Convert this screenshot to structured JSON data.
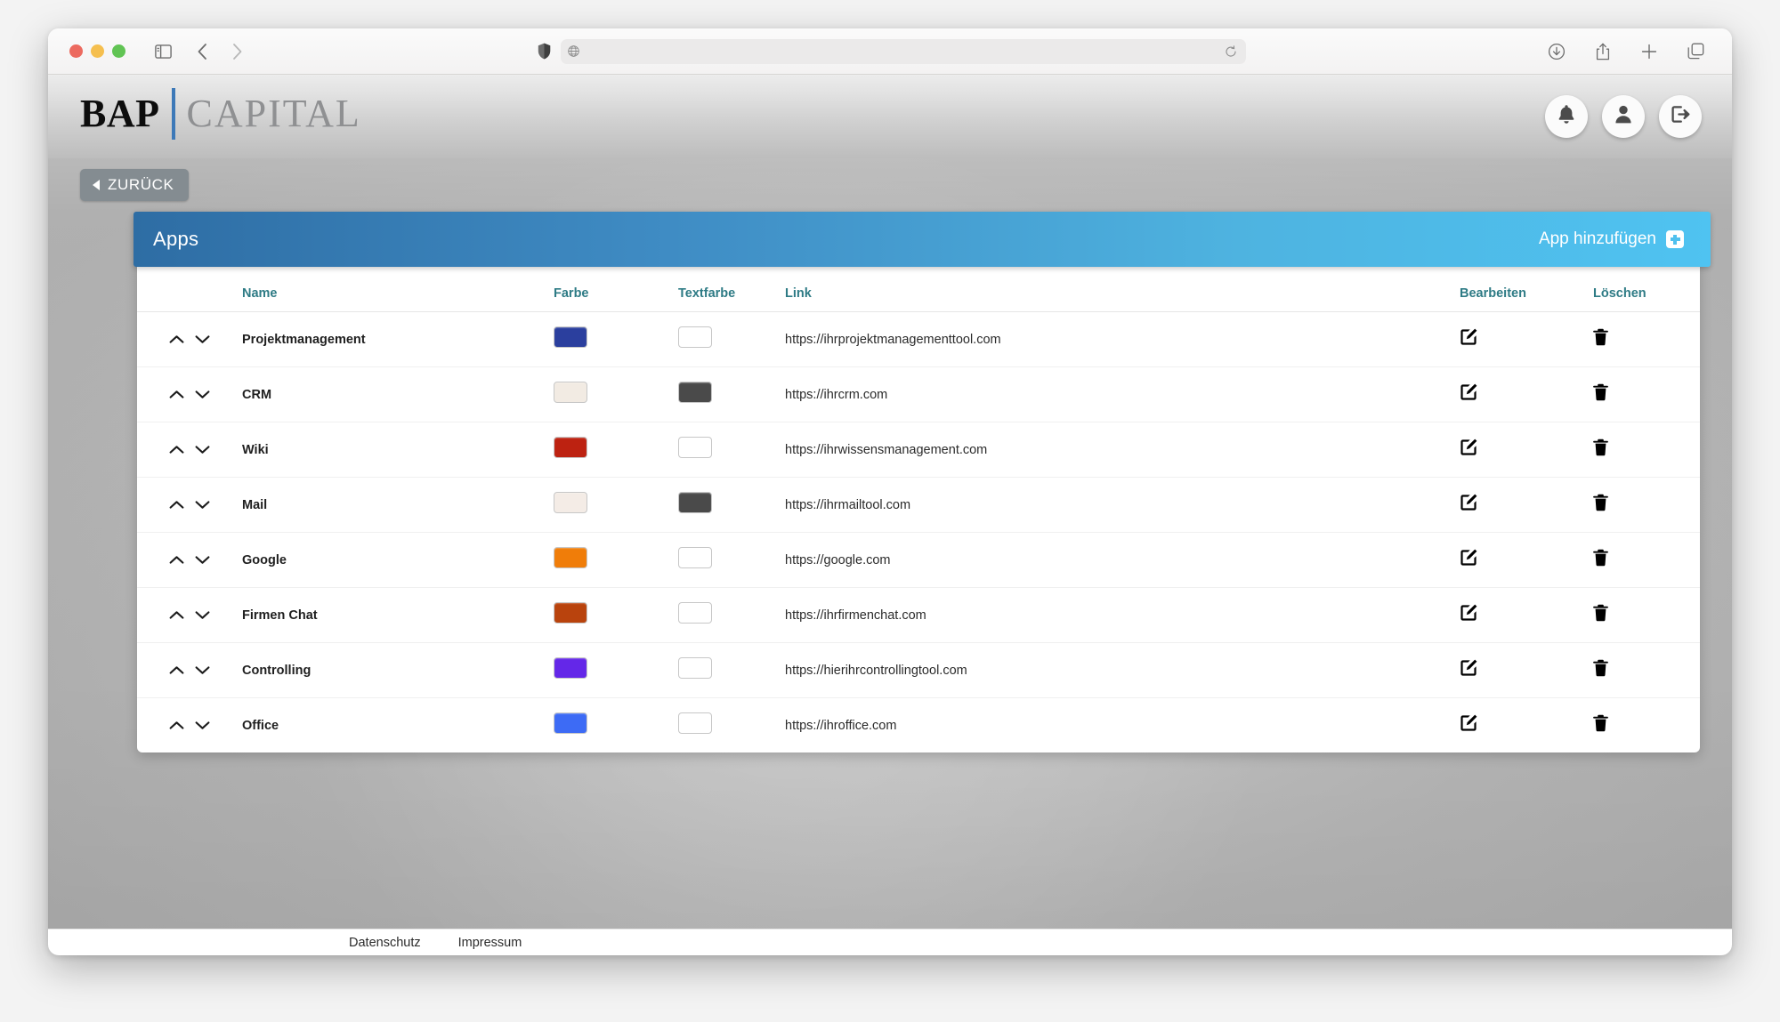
{
  "browser": {
    "url_value": "",
    "url_placeholder": "",
    "icons": {
      "sidebar": "sidebar-toggle-icon",
      "back": "back-arrow-icon",
      "forward": "forward-arrow-icon",
      "shield": "privacy-shield-icon",
      "globe": "globe-icon",
      "reload": "reload-icon",
      "downloads": "downloads-icon",
      "share": "share-icon",
      "new_tab": "new-tab-icon",
      "tab_overview": "tab-overview-icon"
    }
  },
  "header": {
    "logo_primary": "BAP",
    "logo_secondary": "CAPITAL",
    "accent_color": "#3d79b8",
    "actions": [
      {
        "name": "notifications",
        "icon": "bell-icon"
      },
      {
        "name": "profile",
        "icon": "user-icon"
      },
      {
        "name": "logout",
        "icon": "logout-icon"
      }
    ]
  },
  "back_button": {
    "label": "ZURÜCK"
  },
  "panel": {
    "title": "Apps",
    "add_label": "App hinzufügen",
    "header_gradient_from": "#2e6da4",
    "header_gradient_to": "#4fc3f1",
    "columns": {
      "sort": "",
      "name": "Name",
      "farbe": "Farbe",
      "textfarbe": "Textfarbe",
      "link": "Link",
      "bearbeiten": "Bearbeiten",
      "loeschen": "Löschen"
    },
    "header_color": "#2e7b85"
  },
  "rows": [
    {
      "name": "Projektmanagement",
      "farbe": "#2b3f9e",
      "textfarbe": "#ffffff",
      "link": "https://ihrprojektmanagementtool.com"
    },
    {
      "name": "CRM",
      "farbe": "#f2ebe3",
      "textfarbe": "#4a4a4a",
      "link": "https://ihrcrm.com"
    },
    {
      "name": "Wiki",
      "farbe": "#bd2211",
      "textfarbe": "#ffffff",
      "link": "https://ihrwissensmanagement.com"
    },
    {
      "name": "Mail",
      "farbe": "#f4ece6",
      "textfarbe": "#4a4a4a",
      "link": "https://ihrmailtool.com"
    },
    {
      "name": "Google",
      "farbe": "#f07d09",
      "textfarbe": "#ffffff",
      "link": "https://google.com"
    },
    {
      "name": "Firmen Chat",
      "farbe": "#b9430d",
      "textfarbe": "#ffffff",
      "link": "https://ihrfirmenchat.com"
    },
    {
      "name": "Controlling",
      "farbe": "#6427e8",
      "textfarbe": "#ffffff",
      "link": "https://hierihrcontrollingtool.com"
    },
    {
      "name": "Office",
      "farbe": "#3d6bf5",
      "textfarbe": "#ffffff",
      "link": "https://ihroffice.com"
    }
  ],
  "row_icons": {
    "move_up": "chevron-up-icon",
    "move_down": "chevron-down-icon",
    "edit": "edit-pencil-icon",
    "delete": "trash-icon"
  },
  "footer": {
    "links": [
      {
        "label": "Datenschutz"
      },
      {
        "label": "Impressum"
      }
    ]
  }
}
